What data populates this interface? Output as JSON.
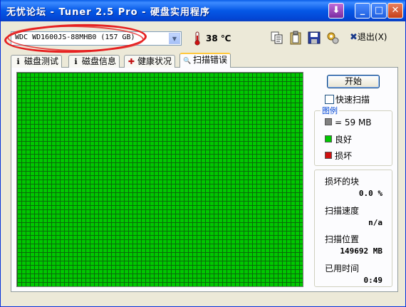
{
  "window": {
    "title": "无忧论坛  - Tuner 2.5 Pro - 硬盘实用程序",
    "buttons": [
      "⬇",
      "_",
      "□",
      "✕"
    ]
  },
  "toolbar": {
    "drive": "WDC WD1600JS-88MHB0 (157 GB)",
    "temperature": "38 ℃",
    "exit_label": "退出(X)",
    "exit_glyph": "✖"
  },
  "tabs": [
    {
      "label": "磁盘测试",
      "icon": "info-icon",
      "glyph": "ℹ"
    },
    {
      "label": "磁盘信息",
      "icon": "info-icon",
      "glyph": "ℹ"
    },
    {
      "label": "健康状况",
      "icon": "health-cross-icon",
      "glyph": "✚"
    },
    {
      "label": "扫描错误",
      "icon": "magnifier-icon",
      "glyph": "🔍",
      "active": true
    }
  ],
  "controls": {
    "start_label": "开始",
    "quick_scan_label": "快速扫描",
    "quick_scan_checked": false
  },
  "legend": {
    "title": "图例",
    "items": [
      {
        "label": "= 59 MB",
        "color": "#808080"
      },
      {
        "label": "良好",
        "color": "#00c800"
      },
      {
        "label": "损坏",
        "color": "#d01010"
      }
    ]
  },
  "stats": {
    "damaged_label": "损坏的块",
    "damaged_value": "0.0 %",
    "speed_label": "扫描速度",
    "speed_value": "n/a",
    "position_label": "扫描位置",
    "position_value": "149692 MB",
    "elapsed_label": "已用时间",
    "elapsed_value": "0:49"
  },
  "colors": {
    "good_block": "#00c800",
    "titlebar": "#0558e6",
    "annotation_circle": "#e62020"
  }
}
